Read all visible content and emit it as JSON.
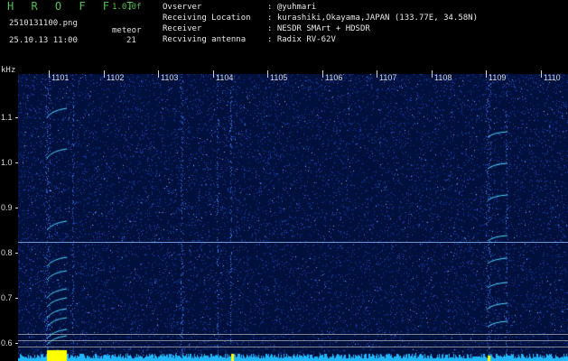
{
  "header": {
    "app_title": "H R O F F T",
    "version": "1.0.0f",
    "filename": "2510131100.png",
    "timestamp": "25.10.13 11:00",
    "meteor_label": "meteor",
    "meteor_count": "21",
    "info": [
      {
        "key": "Ovserver",
        "value": ": @yuhmari"
      },
      {
        "key": "Receiving Location",
        "value": ": kurashiki,Okayama,JAPAN (133.77E, 34.58N)"
      },
      {
        "key": "Receiver",
        "value": ": NESDR SMArt + HDSDR"
      },
      {
        "key": "Recviving antenna",
        "value": ": Radix RV-62V"
      }
    ]
  },
  "axes": {
    "unit": "kHz",
    "x_labels": [
      "1101",
      "1102",
      "1103",
      "1104",
      "1105",
      "1106",
      "1107",
      "1108",
      "1109",
      "1110"
    ],
    "y_labels": [
      "1.1",
      "1.0",
      "0.9",
      "0.8",
      "0.7",
      "0.6"
    ]
  },
  "colors": {
    "background": "#00103d",
    "noise": "#1e3fae",
    "signal": "#4fd7ff",
    "header_green": "#4ec14e",
    "bottom_bar": "#1fb8ff",
    "marker": "#ffff00"
  }
}
